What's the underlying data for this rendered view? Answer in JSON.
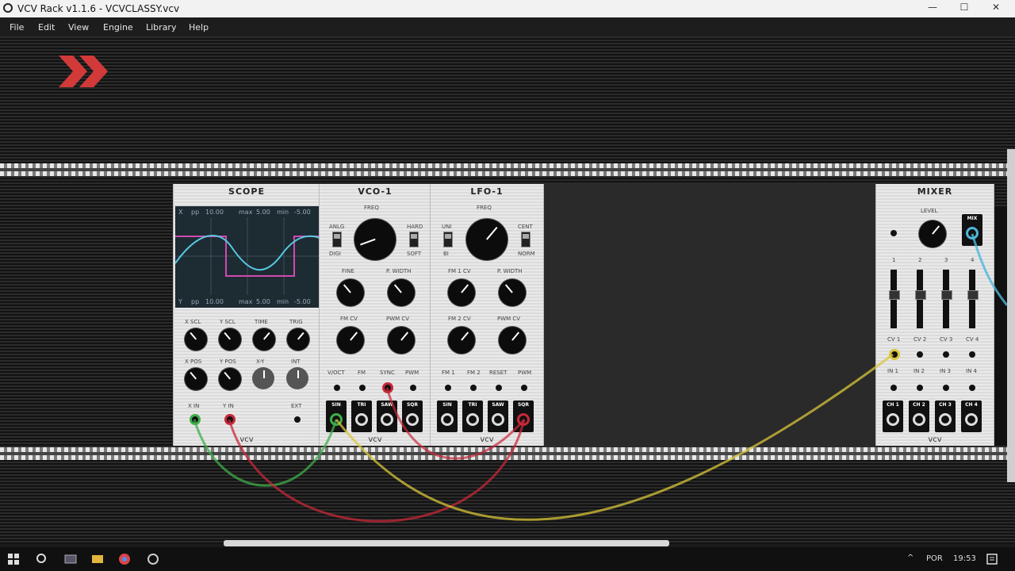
{
  "window": {
    "title": "VCV Rack v1.1.6 - VCVCLASSY.vcv",
    "minimize": "—",
    "maximize": "☐",
    "close": "✕"
  },
  "menu": [
    "File",
    "Edit",
    "View",
    "Engine",
    "Library",
    "Help"
  ],
  "scope": {
    "title": "SCOPE",
    "screen_top": [
      "X",
      "pp",
      "10.00",
      "max",
      "5.00",
      "min",
      "-5.00"
    ],
    "screen_bottom": [
      "Y",
      "pp",
      "10.00",
      "max",
      "5.00",
      "min",
      "-5.00"
    ],
    "labels": [
      "X SCL",
      "Y SCL",
      "TIME",
      "TRIG",
      "X POS",
      "Y POS",
      "X-Y",
      "INT"
    ],
    "port_labels": [
      "X IN",
      "Y IN",
      "EXT"
    ],
    "brand": "vcv"
  },
  "vco": {
    "title": "VCO-1",
    "freq": "FREQ",
    "switch_left": [
      "ANLG",
      "DIGI"
    ],
    "switch_right": [
      "HARD",
      "SOFT"
    ],
    "labels": [
      "FINE",
      "P. WIDTH",
      "FM CV",
      "PWM CV"
    ],
    "input_labels": [
      "V/OCT",
      "FM",
      "SYNC",
      "PWM"
    ],
    "outputs": [
      "SIN",
      "TRI",
      "SAW",
      "SQR"
    ],
    "brand": "vcv"
  },
  "lfo": {
    "title": "LFO-1",
    "freq": "FREQ",
    "switch_left": [
      "UNI",
      "BI"
    ],
    "switch_right": [
      "CENT",
      "NORM"
    ],
    "labels": [
      "FM 1 CV",
      "P. WIDTH",
      "FM 2 CV",
      "PWM CV"
    ],
    "input_labels": [
      "FM 1",
      "FM 2",
      "RESET",
      "PWM"
    ],
    "outputs": [
      "SIN",
      "TRI",
      "SAW",
      "SQR"
    ],
    "brand": "vcv"
  },
  "mixer": {
    "title": "MIXER",
    "level": "LEVEL",
    "mix": "MIX",
    "channels": [
      "1",
      "2",
      "3",
      "4"
    ],
    "cv_labels": [
      "CV 1",
      "CV 2",
      "CV 3",
      "CV 4"
    ],
    "in_labels": [
      "IN 1",
      "IN 2",
      "IN 3",
      "IN 4"
    ],
    "outputs": [
      "CH 1",
      "CH 2",
      "CH 3",
      "CH 4"
    ],
    "brand": "vcv"
  },
  "taskbar": {
    "lang": "POR",
    "time": "19:53"
  },
  "colors": {
    "cable_green": "#3fae4a",
    "cable_red": "#c8283a",
    "cable_yellow": "#d9c63a",
    "cable_blue": "#4fb6d8",
    "logo_red": "#d23a3a"
  }
}
